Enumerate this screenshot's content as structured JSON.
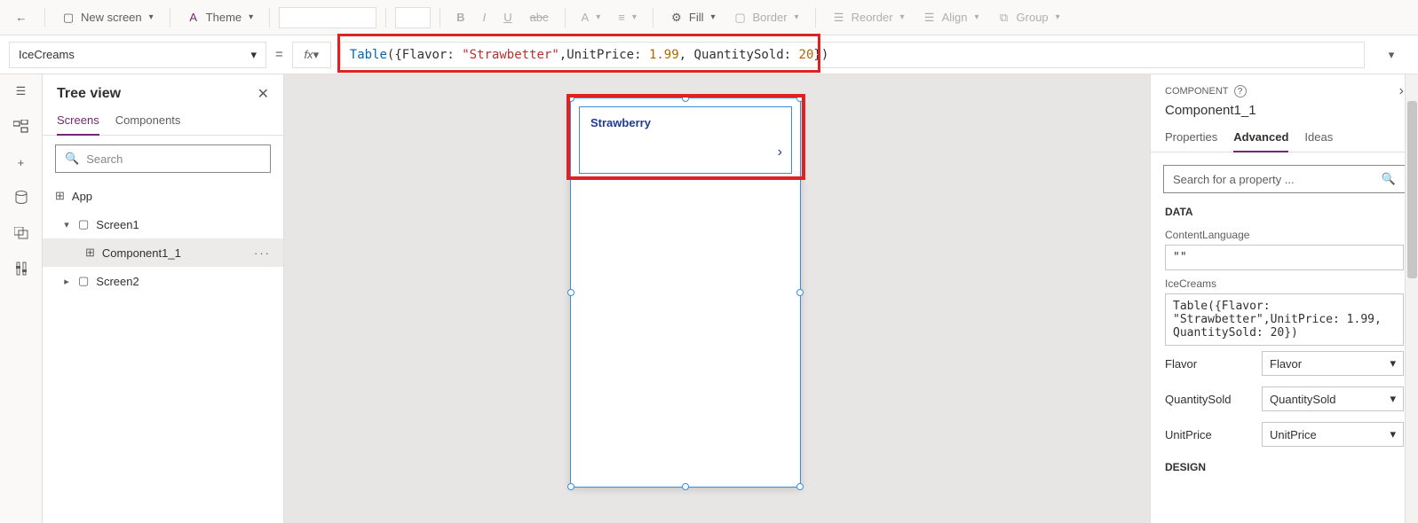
{
  "toolbar": {
    "new_screen": "New screen",
    "theme": "Theme",
    "bold": "B",
    "italic": "I",
    "underline": "U",
    "strike": "abc",
    "fontcolor": "A",
    "align": "≡",
    "fill": "Fill",
    "border": "Border",
    "reorder": "Reorder",
    "align2": "Align",
    "group": "Group"
  },
  "formula": {
    "property": "IceCreams",
    "fx": "fx",
    "tokens": {
      "fn": "Table",
      "open": "({Flavor: ",
      "str": "\"Strawbetter\"",
      "mid1": ",UnitPrice: ",
      "num1": "1.99",
      "mid2": ", QuantitySold: ",
      "num2": "20",
      "close": "})"
    }
  },
  "tree": {
    "title": "Tree view",
    "tabs": {
      "screens": "Screens",
      "components": "Components"
    },
    "search_placeholder": "Search",
    "app": "App",
    "screen1": "Screen1",
    "component": "Component1_1",
    "screen2": "Screen2"
  },
  "canvas": {
    "list_item_text": "Strawberry"
  },
  "right": {
    "section": "COMPONENT",
    "title": "Component1_1",
    "tabs": {
      "properties": "Properties",
      "advanced": "Advanced",
      "ideas": "Ideas"
    },
    "search_placeholder": "Search for a property ...",
    "data_label": "DATA",
    "content_language": "ContentLanguage",
    "content_language_val": "\"\"",
    "icecreams": "IceCreams",
    "icecreams_val": "Table({Flavor: \"Strawbetter\",UnitPrice: 1.99, QuantitySold: 20})",
    "flavor": "Flavor",
    "flavor_val": "Flavor",
    "qty": "QuantitySold",
    "qty_val": "QuantitySold",
    "unitprice": "UnitPrice",
    "unitprice_val": "UnitPrice",
    "design_label": "DESIGN"
  }
}
